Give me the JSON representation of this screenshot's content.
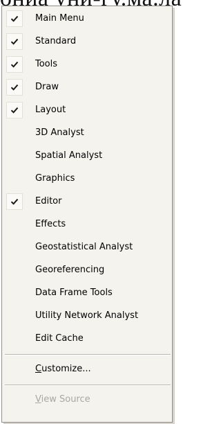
{
  "background_text": "ониа уни-гу.ма.ла",
  "menu": {
    "items": [
      {
        "label": "Main Menu",
        "checked": true
      },
      {
        "label": "Standard",
        "checked": true
      },
      {
        "label": "Tools",
        "checked": true
      },
      {
        "label": "Draw",
        "checked": true
      },
      {
        "label": "Layout",
        "checked": true
      },
      {
        "label": "3D Analyst",
        "checked": false
      },
      {
        "label": "Spatial Analyst",
        "checked": false
      },
      {
        "label": "Graphics",
        "checked": false
      },
      {
        "label": "Editor",
        "checked": true
      },
      {
        "label": "Effects",
        "checked": false
      },
      {
        "label": "Geostatistical Analyst",
        "checked": false
      },
      {
        "label": "Georeferencing",
        "checked": false
      },
      {
        "label": "Data Frame Tools",
        "checked": false
      },
      {
        "label": "Utility Network Analyst",
        "checked": false
      },
      {
        "label": "Edit Cache",
        "checked": false
      }
    ],
    "customize": {
      "prefix": "",
      "mnemonic": "C",
      "rest": "ustomize..."
    },
    "view_source": {
      "prefix": "",
      "mnemonic": "V",
      "rest": "iew Source"
    }
  },
  "icons": {
    "check": "checkmark-icon"
  },
  "colors": {
    "menu_bg": "#f4f3ee",
    "border": "#8e8d89",
    "disabled_text": "#a9a7a2"
  }
}
